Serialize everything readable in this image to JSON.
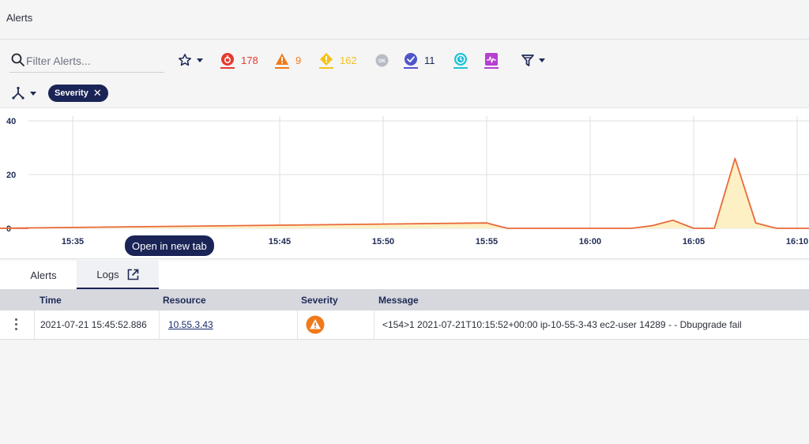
{
  "header": {
    "title": "Alerts"
  },
  "toolbar": {
    "search_placeholder": "Filter Alerts...",
    "critical_count": "178",
    "major_count": "9",
    "minor_count": "162",
    "ok_label": "OK",
    "acknowledged_count": "11",
    "colors": {
      "critical": "#e5392e",
      "major": "#f07a1a",
      "minor": "#f4c21a",
      "ok": "#b9bcc4",
      "acknowledged": "#4f56c9",
      "pending": "#1fc1d6",
      "anomaly": "#b63fd0"
    },
    "icons": [
      "star-icon",
      "critical-icon",
      "major-warning-icon",
      "minor-warning-icon",
      "ok-icon",
      "acknowledged-icon",
      "clock-icon",
      "anomaly-icon",
      "funnel-icon"
    ]
  },
  "filters": {
    "chip_label": "Severity"
  },
  "chart_data": {
    "type": "area",
    "x_ticks": [
      "15:35",
      "15:45",
      "15:50",
      "15:55",
      "16:00",
      "16:05",
      "16:10"
    ],
    "y_ticks": [
      "40",
      "20",
      "0"
    ],
    "ylim": [
      0,
      40
    ],
    "x": [
      "15:31",
      "15:55",
      "15:56",
      "16:02",
      "16:03",
      "16:04",
      "16:05",
      "16:06",
      "16:07",
      "16:08",
      "16:09",
      "16:10"
    ],
    "values": [
      0,
      2,
      0,
      0,
      1,
      3,
      0,
      0,
      26,
      2,
      0,
      0
    ],
    "series_color": "#e86a3a",
    "fill_color": "#fdf0c4",
    "grid": true
  },
  "tooltip": {
    "text": "Open in new tab"
  },
  "tabs": [
    {
      "label": "Alerts"
    },
    {
      "label": "Logs"
    }
  ],
  "table": {
    "columns": [
      "Time",
      "Resource",
      "Severity",
      "Message"
    ],
    "rows": [
      {
        "time": "2021-07-21 15:45:52.886",
        "resource": "10.55.3.43",
        "severity": "major-warning-icon",
        "message": "<154>1 2021-07-21T10:15:52+00:00 ip-10-55-3-43 ec2-user 14289 - - Dbupgrade fail"
      }
    ]
  }
}
